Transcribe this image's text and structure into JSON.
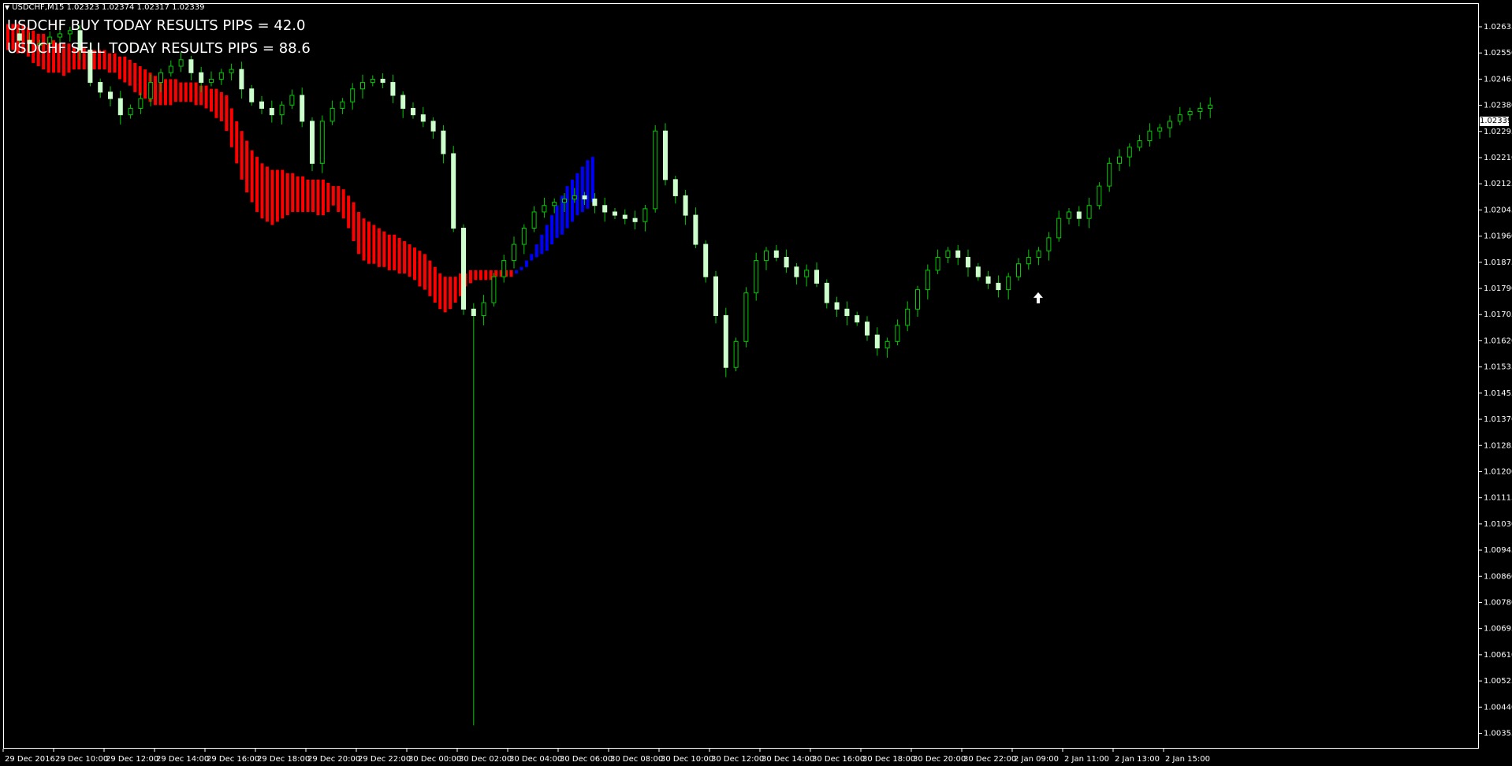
{
  "header": {
    "symbol_info": "USDCHF,M15  1.02323 1.02374 1.02317 1.02339"
  },
  "results": {
    "buy": "USDCHF BUY TODAY RESULTS PIPS = 42.0",
    "sell": "USDCHF SELL TODAY RESULTS PIPS = 88.6"
  },
  "current_price": "1.02339",
  "colors": {
    "background": "#000000",
    "border": "#ffffff",
    "bull_candle": "#ccffcc",
    "wick": "#00cc00",
    "down_band": "#ff0000",
    "up_band": "#0000ff",
    "signal_arrow": "#ffffff"
  },
  "chart_data": {
    "type": "candlestick",
    "title": "USDCHF,M15",
    "y_ticks": [
      "1.02635",
      "1.02550",
      "1.02465",
      "1.02380",
      "1.02295",
      "1.02210",
      "1.02125",
      "1.02045",
      "1.01960",
      "1.01875",
      "1.01790",
      "1.01705",
      "1.01620",
      "1.01535",
      "1.01455",
      "1.01370",
      "1.01285",
      "1.01200",
      "1.01115",
      "1.01030",
      "1.00945",
      "1.00860",
      "1.00780",
      "1.00695",
      "1.00610",
      "1.00525",
      "1.00440",
      "1.00355"
    ],
    "x_ticks": [
      "29 Dec 2016",
      "29 Dec 10:00",
      "29 Dec 12:00",
      "29 Dec 14:00",
      "29 Dec 16:00",
      "29 Dec 18:00",
      "29 Dec 20:00",
      "29 Dec 22:00",
      "30 Dec 00:00",
      "30 Dec 02:00",
      "30 Dec 04:00",
      "30 Dec 06:00",
      "30 Dec 08:00",
      "30 Dec 10:00",
      "30 Dec 12:00",
      "30 Dec 14:00",
      "30 Dec 16:00",
      "30 Dec 18:00",
      "30 Dec 20:00",
      "30 Dec 22:00",
      "2 Jan 09:00",
      "2 Jan 11:00",
      "2 Jan 13:00",
      "2 Jan 15:00"
    ],
    "ylim": [
      1.00355,
      1.02635
    ],
    "close_path": [
      1.0255,
      1.0253,
      1.0252,
      1.0252,
      1.0254,
      1.0255,
      1.0256,
      1.025,
      1.024,
      1.0237,
      1.0235,
      1.023,
      1.0232,
      1.0235,
      1.024,
      1.0243,
      1.0245,
      1.0247,
      1.0243,
      1.024,
      1.0241,
      1.0243,
      1.0244,
      1.0238,
      1.0234,
      1.0232,
      1.023,
      1.0233,
      1.0236,
      1.0228,
      1.0215,
      1.0228,
      1.0232,
      1.0234,
      1.0238,
      1.024,
      1.0241,
      1.024,
      1.0236,
      1.0232,
      1.023,
      1.0228,
      1.0225,
      1.0218,
      1.0195,
      1.017,
      1.0168,
      1.0172,
      1.018,
      1.0185,
      1.019,
      1.0195,
      1.02,
      1.0202,
      1.0203,
      1.0204,
      1.0205,
      1.0204,
      1.0202,
      1.02,
      1.0199,
      1.0198,
      1.0197,
      1.0201,
      1.0225,
      1.021,
      1.0205,
      1.0199,
      1.019,
      1.018,
      1.0168,
      1.0152,
      1.016,
      1.0175,
      1.0185,
      1.0188,
      1.0186,
      1.0183,
      1.018,
      1.0182,
      1.0178,
      1.0172,
      1.017,
      1.0168,
      1.0166,
      1.0162,
      1.0158,
      1.016,
      1.0165,
      1.017,
      1.0176,
      1.0182,
      1.0186,
      1.0188,
      1.0186,
      1.0183,
      1.018,
      1.0178,
      1.0176,
      1.018,
      1.0184,
      1.0186,
      1.0188,
      1.0192,
      1.0198,
      1.02,
      1.0198,
      1.0202,
      1.0208,
      1.0215,
      1.0217,
      1.022,
      1.0222,
      1.0225,
      1.0226,
      1.0228,
      1.023,
      1.0231,
      1.0232,
      1.0233
    ],
    "band": [
      {
        "trend": "down",
        "from": 1.0258,
        "to": 1.025
      },
      {
        "trend": "down",
        "from": 1.0258,
        "to": 1.025
      },
      {
        "trend": "down",
        "from": 1.0258,
        "to": 1.0249
      },
      {
        "trend": "down",
        "from": 1.0258,
        "to": 1.0249
      },
      {
        "trend": "down",
        "from": 1.0257,
        "to": 1.0248
      },
      {
        "trend": "down",
        "from": 1.0256,
        "to": 1.0246
      },
      {
        "trend": "down",
        "from": 1.0255,
        "to": 1.0245
      },
      {
        "trend": "down",
        "from": 1.0255,
        "to": 1.0244
      },
      {
        "trend": "down",
        "from": 1.0254,
        "to": 1.0243
      },
      {
        "trend": "down",
        "from": 1.0253,
        "to": 1.0243
      },
      {
        "trend": "down",
        "from": 1.0252,
        "to": 1.0243
      },
      {
        "trend": "down",
        "from": 1.0252,
        "to": 1.0242
      },
      {
        "trend": "down",
        "from": 1.0252,
        "to": 1.0243
      },
      {
        "trend": "down",
        "from": 1.0251,
        "to": 1.0244
      },
      {
        "trend": "down",
        "from": 1.0251,
        "to": 1.0244
      },
      {
        "trend": "down",
        "from": 1.0251,
        "to": 1.0244
      },
      {
        "trend": "down",
        "from": 1.025,
        "to": 1.0244
      },
      {
        "trend": "down",
        "from": 1.025,
        "to": 1.0244
      },
      {
        "trend": "down",
        "from": 1.025,
        "to": 1.0244
      },
      {
        "trend": "down",
        "from": 1.025,
        "to": 1.0244
      },
      {
        "trend": "down",
        "from": 1.0249,
        "to": 1.0243
      },
      {
        "trend": "down",
        "from": 1.0249,
        "to": 1.0243
      },
      {
        "trend": "down",
        "from": 1.0248,
        "to": 1.0241
      },
      {
        "trend": "down",
        "from": 1.0248,
        "to": 1.024
      },
      {
        "trend": "down",
        "from": 1.0247,
        "to": 1.0239
      },
      {
        "trend": "down",
        "from": 1.0246,
        "to": 1.0237
      },
      {
        "trend": "down",
        "from": 1.0245,
        "to": 1.0236
      },
      {
        "trend": "down",
        "from": 1.0244,
        "to": 1.0235
      },
      {
        "trend": "down",
        "from": 1.0243,
        "to": 1.0234
      },
      {
        "trend": "down",
        "from": 1.0242,
        "to": 1.0233
      },
      {
        "trend": "down",
        "from": 1.0242,
        "to": 1.0233
      },
      {
        "trend": "down",
        "from": 1.0241,
        "to": 1.0233
      },
      {
        "trend": "down",
        "from": 1.0241,
        "to": 1.0233
      },
      {
        "trend": "down",
        "from": 1.0241,
        "to": 1.0234
      },
      {
        "trend": "down",
        "from": 1.024,
        "to": 1.0234
      },
      {
        "trend": "down",
        "from": 1.024,
        "to": 1.0234
      },
      {
        "trend": "down",
        "from": 1.024,
        "to": 1.0234
      },
      {
        "trend": "down",
        "from": 1.024,
        "to": 1.0233
      },
      {
        "trend": "down",
        "from": 1.0239,
        "to": 1.0233
      },
      {
        "trend": "down",
        "from": 1.0239,
        "to": 1.0232
      },
      {
        "trend": "down",
        "from": 1.0238,
        "to": 1.0231
      },
      {
        "trend": "down",
        "from": 1.0238,
        "to": 1.0229
      },
      {
        "trend": "down",
        "from": 1.0237,
        "to": 1.0228
      },
      {
        "trend": "down",
        "from": 1.0236,
        "to": 1.0225
      },
      {
        "trend": "down",
        "from": 1.0232,
        "to": 1.022
      },
      {
        "trend": "down",
        "from": 1.0228,
        "to": 1.0215
      },
      {
        "trend": "down",
        "from": 1.0225,
        "to": 1.021
      },
      {
        "trend": "down",
        "from": 1.0222,
        "to": 1.0206
      },
      {
        "trend": "down",
        "from": 1.0219,
        "to": 1.0203
      },
      {
        "trend": "down",
        "from": 1.0217,
        "to": 1.02
      },
      {
        "trend": "down",
        "from": 1.0215,
        "to": 1.0198
      },
      {
        "trend": "down",
        "from": 1.0214,
        "to": 1.0197
      },
      {
        "trend": "down",
        "from": 1.0213,
        "to": 1.0196
      },
      {
        "trend": "down",
        "from": 1.0213,
        "to": 1.0197
      },
      {
        "trend": "down",
        "from": 1.0213,
        "to": 1.0198
      },
      {
        "trend": "down",
        "from": 1.0212,
        "to": 1.0199
      },
      {
        "trend": "down",
        "from": 1.0212,
        "to": 1.02
      },
      {
        "trend": "down",
        "from": 1.0211,
        "to": 1.02
      },
      {
        "trend": "down",
        "from": 1.0211,
        "to": 1.02
      },
      {
        "trend": "down",
        "from": 1.021,
        "to": 1.02
      },
      {
        "trend": "down",
        "from": 1.021,
        "to": 1.02
      },
      {
        "trend": "down",
        "from": 1.021,
        "to": 1.0199
      },
      {
        "trend": "down",
        "from": 1.021,
        "to": 1.0199
      },
      {
        "trend": "down",
        "from": 1.0209,
        "to": 1.02
      },
      {
        "trend": "down",
        "from": 1.0208,
        "to": 1.0202
      },
      {
        "trend": "down",
        "from": 1.0208,
        "to": 1.02
      },
      {
        "trend": "down",
        "from": 1.0207,
        "to": 1.0198
      },
      {
        "trend": "down",
        "from": 1.0205,
        "to": 1.0195
      },
      {
        "trend": "down",
        "from": 1.0203,
        "to": 1.0191
      },
      {
        "trend": "down",
        "from": 1.02,
        "to": 1.0187
      },
      {
        "trend": "down",
        "from": 1.0198,
        "to": 1.0185
      },
      {
        "trend": "down",
        "from": 1.0197,
        "to": 1.0184
      },
      {
        "trend": "down",
        "from": 1.0196,
        "to": 1.0184
      },
      {
        "trend": "down",
        "from": 1.0195,
        "to": 1.0183
      },
      {
        "trend": "down",
        "from": 1.0194,
        "to": 1.0183
      },
      {
        "trend": "down",
        "from": 1.0193,
        "to": 1.0182
      },
      {
        "trend": "down",
        "from": 1.0193,
        "to": 1.0182
      },
      {
        "trend": "down",
        "from": 1.0192,
        "to": 1.0181
      },
      {
        "trend": "down",
        "from": 1.0191,
        "to": 1.0181
      },
      {
        "trend": "down",
        "from": 1.019,
        "to": 1.018
      },
      {
        "trend": "down",
        "from": 1.0189,
        "to": 1.0179
      },
      {
        "trend": "down",
        "from": 1.0188,
        "to": 1.0177
      },
      {
        "trend": "down",
        "from": 1.0187,
        "to": 1.0176
      },
      {
        "trend": "down",
        "from": 1.0185,
        "to": 1.0174
      },
      {
        "trend": "down",
        "from": 1.0183,
        "to": 1.0172
      },
      {
        "trend": "down",
        "from": 1.0181,
        "to": 1.017
      },
      {
        "trend": "down",
        "from": 1.018,
        "to": 1.0169
      },
      {
        "trend": "down",
        "from": 1.018,
        "to": 1.017
      },
      {
        "trend": "down",
        "from": 1.018,
        "to": 1.0172
      },
      {
        "trend": "down",
        "from": 1.0181,
        "to": 1.0174
      },
      {
        "trend": "down",
        "from": 1.0181,
        "to": 1.0177
      },
      {
        "trend": "down",
        "from": 1.0182,
        "to": 1.0178
      },
      {
        "trend": "down",
        "from": 1.0182,
        "to": 1.0179
      },
      {
        "trend": "down",
        "from": 1.0182,
        "to": 1.0179
      },
      {
        "trend": "down",
        "from": 1.0182,
        "to": 1.0179
      },
      {
        "trend": "down",
        "from": 1.0182,
        "to": 1.0179
      },
      {
        "trend": "down",
        "from": 1.0182,
        "to": 1.018
      },
      {
        "trend": "down",
        "from": 1.0182,
        "to": 1.018
      },
      {
        "trend": "down",
        "from": 1.0182,
        "to": 1.018
      },
      {
        "trend": "down",
        "from": 1.0182,
        "to": 1.018
      },
      {
        "trend": "up",
        "from": 1.0182,
        "to": 1.0181
      },
      {
        "trend": "up",
        "from": 1.0183,
        "to": 1.0182
      },
      {
        "trend": "up",
        "from": 1.0185,
        "to": 1.0183
      },
      {
        "trend": "up",
        "from": 1.0187,
        "to": 1.0185
      },
      {
        "trend": "up",
        "from": 1.019,
        "to": 1.0186
      },
      {
        "trend": "up",
        "from": 1.0193,
        "to": 1.0187
      },
      {
        "trend": "up",
        "from": 1.0196,
        "to": 1.0188
      },
      {
        "trend": "up",
        "from": 1.0199,
        "to": 1.019
      },
      {
        "trend": "up",
        "from": 1.0202,
        "to": 1.0192
      },
      {
        "trend": "up",
        "from": 1.0205,
        "to": 1.0193
      },
      {
        "trend": "up",
        "from": 1.0208,
        "to": 1.0195
      },
      {
        "trend": "up",
        "from": 1.021,
        "to": 1.0197
      },
      {
        "trend": "up",
        "from": 1.0212,
        "to": 1.0199
      },
      {
        "trend": "up",
        "from": 1.0214,
        "to": 1.02
      },
      {
        "trend": "up",
        "from": 1.0216,
        "to": 1.0201
      },
      {
        "trend": "up",
        "from": 1.0217,
        "to": 1.0203
      }
    ],
    "spike": {
      "low": 1.00415,
      "at_close_index": 46
    },
    "signal": {
      "type": "buy-arrow",
      "price": 1.01735
    }
  }
}
